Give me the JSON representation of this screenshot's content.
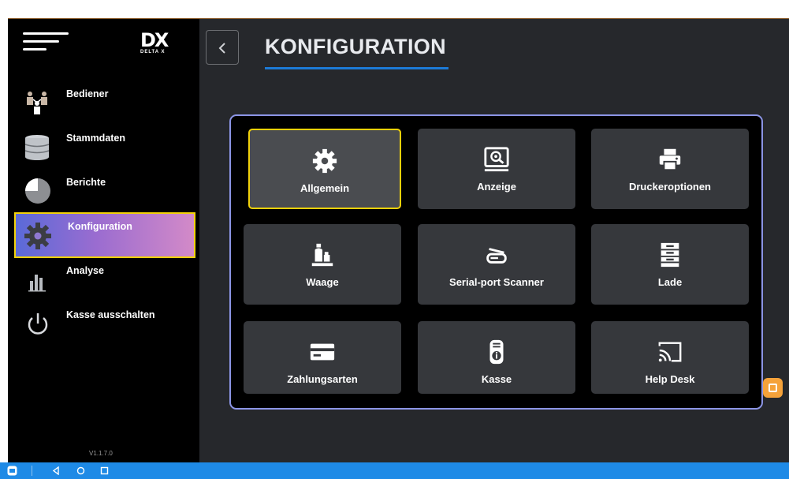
{
  "sidebar": {
    "logo_mark": "DX",
    "logo_sub": "DELTA X",
    "items": [
      {
        "label": "Bediener",
        "icon": "users-icon"
      },
      {
        "label": "Stammdaten",
        "icon": "database-icon"
      },
      {
        "label": "Berichte",
        "icon": "pie-chart-icon"
      },
      {
        "label": "Konfiguration",
        "icon": "gear-icon",
        "active": true
      },
      {
        "label": "Analyse",
        "icon": "bar-chart-icon"
      },
      {
        "label": "Kasse ausschalten",
        "icon": "power-icon"
      }
    ],
    "version": "V1.1.7.0"
  },
  "header": {
    "title": "KONFIGURATION"
  },
  "tiles": [
    {
      "label": "Allgemein",
      "icon": "gear-icon",
      "selected": true
    },
    {
      "label": "Anzeige",
      "icon": "monitor-search-icon"
    },
    {
      "label": "Druckeroptionen",
      "icon": "printer-icon"
    },
    {
      "label": "Waage",
      "icon": "scale-bottles-icon"
    },
    {
      "label": "Serial-port Scanner",
      "icon": "scanner-icon"
    },
    {
      "label": "Lade",
      "icon": "cash-drawer-icon"
    },
    {
      "label": "Zahlungsarten",
      "icon": "credit-card-icon"
    },
    {
      "label": "Kasse",
      "icon": "info-terminal-icon"
    },
    {
      "label": "Help Desk",
      "icon": "cast-icon"
    }
  ],
  "colors": {
    "accent_underline": "#1c7ad6",
    "selection_border": "#f2d20a",
    "panel_border": "#8c95e6",
    "android_navbar": "#1e8ae6",
    "side_badge": "#f5a23a"
  },
  "android_nav": {
    "icons": [
      "app-icon",
      "back-triangle-icon",
      "home-circle-icon",
      "recents-square-icon"
    ]
  }
}
